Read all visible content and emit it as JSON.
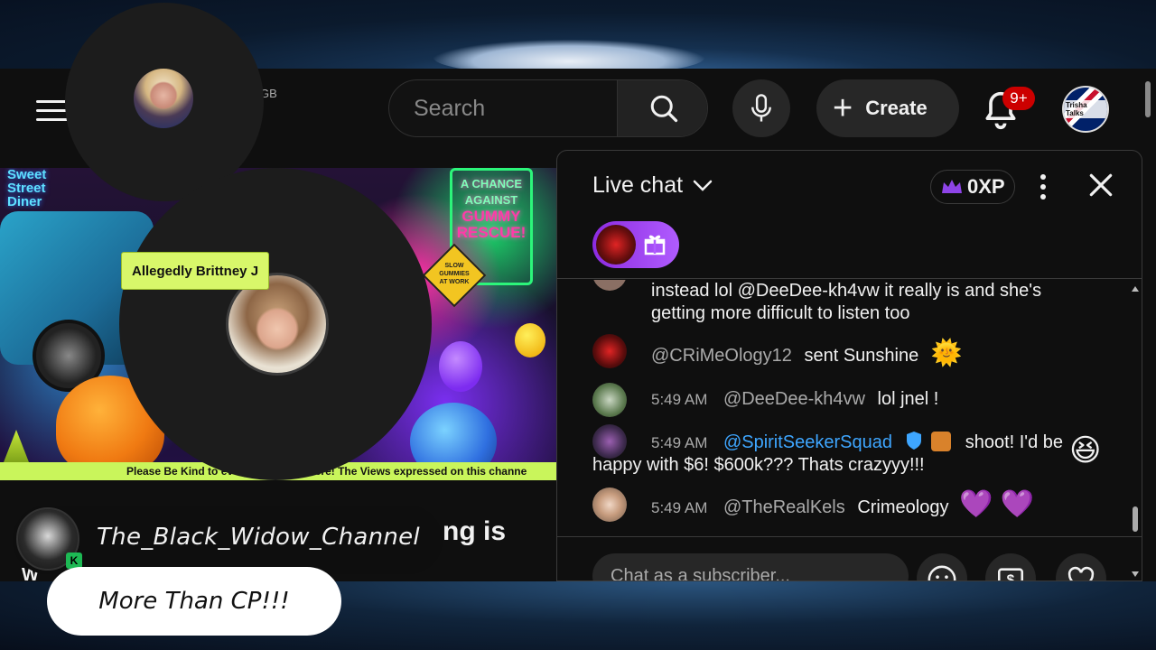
{
  "topbar": {
    "region_code": "GB",
    "search_placeholder": "Search",
    "create_label": "Create",
    "notification_count": "9+",
    "account_badge": "Trisha Talks"
  },
  "video": {
    "sign_left": "Sweet\nStreet\nDiner",
    "sign_right_top": "A CHANCE AGAINST",
    "sign_right_main": "GUMMY RESCUE!",
    "road_sign": "SLOW GUMMIES AT WORK",
    "name_tag": "Allegedly Brittney J",
    "ticker": "Please Be Kind to everyone everywhere! The Views expressed on this channe"
  },
  "title_fragment": "ng is",
  "title_fragment2": "W",
  "chat": {
    "title": "Live chat",
    "xp": "0XP",
    "messages": [
      {
        "text": "instead lol @DeeDee-kh4vw it really is and she's getting more difficult to listen too"
      },
      {
        "author": "@CRiMeOlogy12",
        "text": "sent Sunshine",
        "emoji": "🌞"
      },
      {
        "time": "5:49 AM",
        "author": "@DeeDee-kh4vw",
        "text": "lol jnel !"
      },
      {
        "time": "5:49 AM",
        "author": "@SpiritSeekerSquad",
        "text": "shoot! I'd be happy with $6! $600k??? Thats crazyyy!!!",
        "emoji": "😆"
      },
      {
        "time": "5:49 AM",
        "author": "@TheRealKels",
        "text": "Crimeology",
        "emoji": "💜 💜"
      }
    ],
    "input_placeholder": "Chat as a subscriber..."
  },
  "overlay": {
    "channel_badge": "K",
    "channel_name": "The_Black_Widow_Channel",
    "tagline": "More Than CP!!!"
  },
  "colors": {
    "accent_blue": "#3ea6ff",
    "notification_red": "#cc0000",
    "gift_purple": "#9b3ff0",
    "ticker_green": "#c9f55b"
  }
}
